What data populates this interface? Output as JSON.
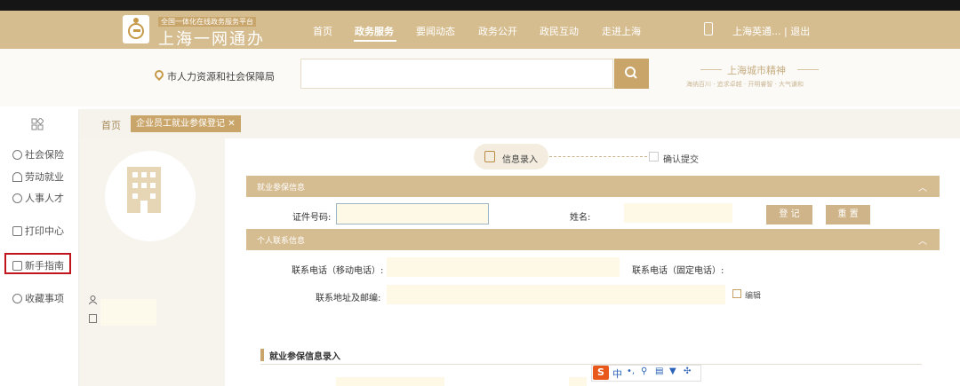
{
  "header": {
    "logo_small": "全国一体化在线政务服务平台",
    "logo_big": "上海一网通办",
    "nav": [
      "首页",
      "政务服务",
      "要闻动态",
      "政务公开",
      "政民互动",
      "走进上海"
    ],
    "active_nav": "政务服务",
    "user": "上海英通...  |  退出"
  },
  "search": {
    "location": "市人力资源和社会保障局",
    "value": "",
    "placeholder": "",
    "slogan_title": "上海城市精神",
    "slogan_sub": "海纳百川 · 追求卓越 · 开明睿智 · 大气谦和"
  },
  "sidebar": {
    "items": [
      {
        "label": "社会保险",
        "icon": "umbrella-icon"
      },
      {
        "label": "劳动就业",
        "icon": "worker-icon"
      },
      {
        "label": "人事人才",
        "icon": "people-icon"
      },
      {
        "label": "打印中心",
        "icon": "printer-icon"
      },
      {
        "label": "新手指南",
        "icon": "guide-icon"
      },
      {
        "label": "收藏事项",
        "icon": "star-icon"
      }
    ]
  },
  "tabs": {
    "home": "首页",
    "active": "企业员工就业参保登记"
  },
  "steps": {
    "step1": "信息录入",
    "step2": "确认提交"
  },
  "sections": {
    "employment": "就业参保信息",
    "contact": "个人联系信息",
    "entry": "就业参保信息录入"
  },
  "form": {
    "id_label": "证件号码:",
    "name_label": "姓名:",
    "register_btn": "登 记",
    "reset_btn": "重 置",
    "mobile_label": "联系电话（移动电话）:",
    "landline_label": "联系电话（固定电话）:",
    "address_label": "联系地址及邮编:",
    "edit_label": "编辑"
  },
  "ime": {
    "zh": "中"
  },
  "colors": {
    "brand": "#d6bd90",
    "accent": "#c9a56a",
    "highlight": "#c0151c"
  }
}
